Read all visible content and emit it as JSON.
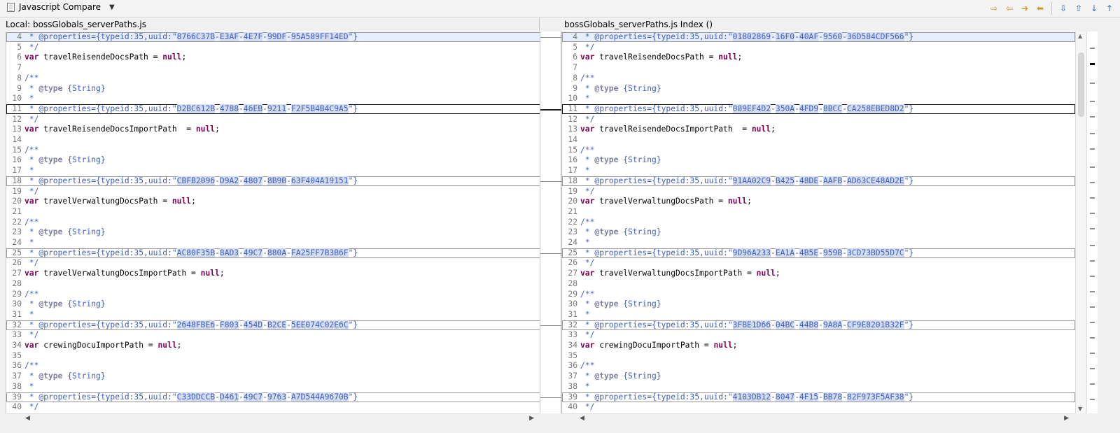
{
  "toolbar": {
    "title": "Javascript Compare"
  },
  "left": {
    "header": "Local: bossGlobals_serverPaths.js",
    "lines": [
      {
        "n": "4",
        "t": "uuid",
        "uuid": [
          "8766C37B",
          "E3AF",
          "4E7F",
          "99DF",
          "95A589FF14ED"
        ]
      },
      {
        "n": "5",
        "t": "close"
      },
      {
        "n": "6",
        "t": "var",
        "name": "travelReisendeDocsPath = "
      },
      {
        "n": "7",
        "t": "blank"
      },
      {
        "n": "8",
        "t": "open"
      },
      {
        "n": "9",
        "t": "type"
      },
      {
        "n": "10",
        "t": "star"
      },
      {
        "n": "11",
        "t": "uuid",
        "uuid": [
          "D2BC612B",
          "4788",
          "46EB",
          "9211",
          "F2F5B4B4C9A5"
        ]
      },
      {
        "n": "12",
        "t": "close"
      },
      {
        "n": "13",
        "t": "var",
        "name": "travelReisendeDocsImportPath  = "
      },
      {
        "n": "14",
        "t": "blank"
      },
      {
        "n": "15",
        "t": "open"
      },
      {
        "n": "16",
        "t": "type"
      },
      {
        "n": "17",
        "t": "star"
      },
      {
        "n": "18",
        "t": "uuid",
        "uuid": [
          "CBFB2096",
          "D9A2",
          "4807",
          "8B9B",
          "63F404A19151"
        ]
      },
      {
        "n": "19",
        "t": "close"
      },
      {
        "n": "20",
        "t": "var",
        "name": "travelVerwaltungDocsPath = "
      },
      {
        "n": "21",
        "t": "blank"
      },
      {
        "n": "22",
        "t": "open"
      },
      {
        "n": "23",
        "t": "type"
      },
      {
        "n": "24",
        "t": "star"
      },
      {
        "n": "25",
        "t": "uuid",
        "uuid": [
          "AC80F35B",
          "8AD3",
          "49C7",
          "880A",
          "FA25FF7B3B6F"
        ]
      },
      {
        "n": "26",
        "t": "close"
      },
      {
        "n": "27",
        "t": "var",
        "name": "travelVerwaltungDocsImportPath = "
      },
      {
        "n": "28",
        "t": "blank"
      },
      {
        "n": "29",
        "t": "open"
      },
      {
        "n": "30",
        "t": "type"
      },
      {
        "n": "31",
        "t": "star"
      },
      {
        "n": "32",
        "t": "uuid",
        "uuid": [
          "2648FBE6",
          "F803",
          "454D",
          "B2CE",
          "5EE074C02E6C"
        ]
      },
      {
        "n": "33",
        "t": "close"
      },
      {
        "n": "34",
        "t": "var",
        "name": "crewingDocuImportPath = "
      },
      {
        "n": "35",
        "t": "blank"
      },
      {
        "n": "36",
        "t": "open"
      },
      {
        "n": "37",
        "t": "type"
      },
      {
        "n": "38",
        "t": "star"
      },
      {
        "n": "39",
        "t": "uuid",
        "uuid": [
          "C33DDCCB",
          "D461",
          "49C7",
          "9763",
          "A7D544A9670B"
        ]
      },
      {
        "n": "40",
        "t": "close"
      }
    ]
  },
  "right": {
    "header": "bossGlobals_serverPaths.js Index ()",
    "lines": [
      {
        "n": "4",
        "t": "uuid",
        "uuid": [
          "01802869",
          "16F0",
          "40AF",
          "9560",
          "36D584CDF566"
        ]
      },
      {
        "n": "5",
        "t": "close"
      },
      {
        "n": "6",
        "t": "var",
        "name": "travelReisendeDocsPath = "
      },
      {
        "n": "7",
        "t": "blank"
      },
      {
        "n": "8",
        "t": "open"
      },
      {
        "n": "9",
        "t": "type"
      },
      {
        "n": "10",
        "t": "star"
      },
      {
        "n": "11",
        "t": "uuid",
        "uuid": [
          "089EF4D2",
          "350A",
          "4FD9",
          "8BCC",
          "CA258EBED8D2"
        ]
      },
      {
        "n": "12",
        "t": "close"
      },
      {
        "n": "13",
        "t": "var",
        "name": "travelReisendeDocsImportPath  = "
      },
      {
        "n": "14",
        "t": "blank"
      },
      {
        "n": "15",
        "t": "open"
      },
      {
        "n": "16",
        "t": "type"
      },
      {
        "n": "17",
        "t": "star"
      },
      {
        "n": "18",
        "t": "uuid",
        "uuid": [
          "91AA02C9",
          "B425",
          "48DE",
          "AAFB",
          "AD63CE48AD2E"
        ]
      },
      {
        "n": "19",
        "t": "close"
      },
      {
        "n": "20",
        "t": "var",
        "name": "travelVerwaltungDocsPath = "
      },
      {
        "n": "21",
        "t": "blank"
      },
      {
        "n": "22",
        "t": "open"
      },
      {
        "n": "23",
        "t": "type"
      },
      {
        "n": "24",
        "t": "star"
      },
      {
        "n": "25",
        "t": "uuid",
        "uuid": [
          "9D96A233",
          "EA1A",
          "4B5E",
          "959B",
          "3CD73BD55D7C"
        ]
      },
      {
        "n": "26",
        "t": "close"
      },
      {
        "n": "27",
        "t": "var",
        "name": "travelVerwaltungDocsImportPath = "
      },
      {
        "n": "28",
        "t": "blank"
      },
      {
        "n": "29",
        "t": "open"
      },
      {
        "n": "30",
        "t": "type"
      },
      {
        "n": "31",
        "t": "star"
      },
      {
        "n": "32",
        "t": "uuid",
        "uuid": [
          "3FBE1D66",
          "04BC",
          "44B8",
          "9A8A",
          "CF9E8201B32F"
        ]
      },
      {
        "n": "33",
        "t": "close"
      },
      {
        "n": "34",
        "t": "var",
        "name": "crewingDocuImportPath = "
      },
      {
        "n": "35",
        "t": "blank"
      },
      {
        "n": "36",
        "t": "open"
      },
      {
        "n": "37",
        "t": "type"
      },
      {
        "n": "38",
        "t": "star"
      },
      {
        "n": "39",
        "t": "uuid",
        "uuid": [
          "4103DB12",
          "8047",
          "4F15",
          "BB78",
          "82F973F5AF38"
        ]
      },
      {
        "n": "40",
        "t": "close"
      }
    ]
  },
  "tokens": {
    "props_prefix": " * @properties={typeid:35,uuid:\"",
    "props_suffix": "\"}",
    "close": " */",
    "open": "/**",
    "star": " *",
    "type_prefix": " * ",
    "type_tag": "@type",
    "type_value": " {String}",
    "var_kw": "var",
    "null_kw": "null",
    "semicolon": ";"
  },
  "colors": {
    "comment": "#3f5fbf",
    "keyword": "#7f0055",
    "diff_highlight": "#d4dcef"
  },
  "selected_diff_line": "11"
}
